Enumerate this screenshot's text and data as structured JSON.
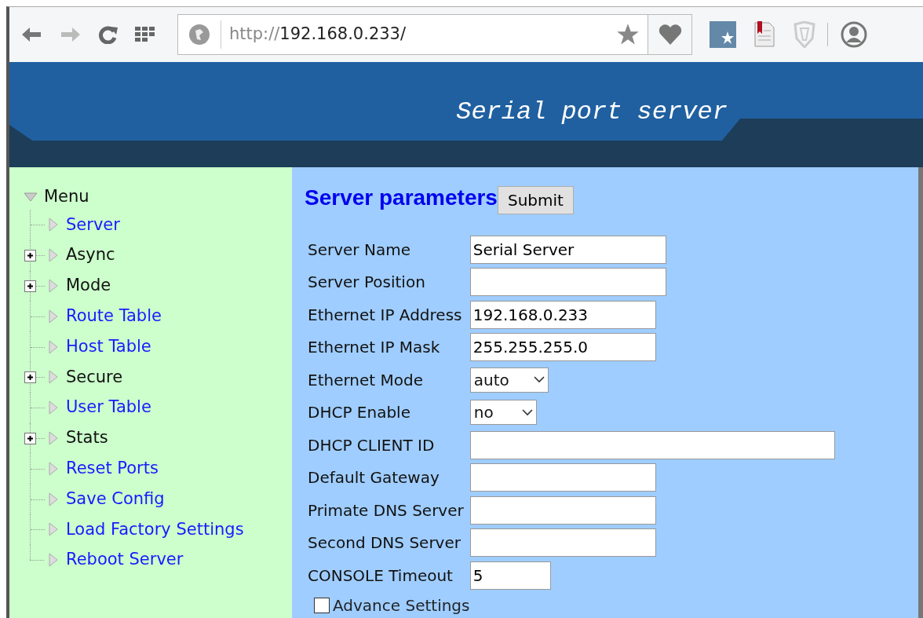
{
  "browser": {
    "url_scheme": "http://",
    "url_host": "192.168.0.233/"
  },
  "banner": {
    "title": "Serial port server"
  },
  "menu": {
    "title": "Menu",
    "expanded": true,
    "items": [
      {
        "label": "Server",
        "kind": "link"
      },
      {
        "label": "Async",
        "kind": "folder"
      },
      {
        "label": "Mode",
        "kind": "folder"
      },
      {
        "label": "Route Table",
        "kind": "link"
      },
      {
        "label": "Host Table",
        "kind": "link"
      },
      {
        "label": "Secure",
        "kind": "folder"
      },
      {
        "label": "User Table",
        "kind": "link"
      },
      {
        "label": "Stats",
        "kind": "folder"
      },
      {
        "label": "Reset Ports",
        "kind": "link"
      },
      {
        "label": "Save Config",
        "kind": "link"
      },
      {
        "label": "Load Factory Settings",
        "kind": "link"
      },
      {
        "label": "Reboot Server",
        "kind": "link"
      }
    ]
  },
  "form": {
    "title": "Server parameters",
    "submit": "Submit",
    "fields": [
      {
        "label": "Server Name",
        "kind": "text",
        "value": "Serial Server"
      },
      {
        "label": "Server Position",
        "kind": "text"
      },
      {
        "label": "Ethernet IP Address",
        "kind": "text",
        "value": "192.168.0.233"
      },
      {
        "label": "Ethernet IP Mask",
        "kind": "text",
        "value": "255.255.255.0"
      },
      {
        "label": "Ethernet Mode",
        "kind": "select",
        "value": "auto"
      },
      {
        "label": "DHCP Enable",
        "kind": "select",
        "value": "no"
      },
      {
        "label": "DHCP CLIENT ID",
        "kind": "text"
      },
      {
        "label": "Default Gateway",
        "kind": "text"
      },
      {
        "label": "Primate DNS Server",
        "kind": "text"
      },
      {
        "label": "Second DNS Server",
        "kind": "text"
      },
      {
        "label": "CONSOLE Timeout",
        "kind": "text",
        "value": "5"
      }
    ],
    "advance": {
      "label": "Advance Settings",
      "checked": false
    }
  }
}
